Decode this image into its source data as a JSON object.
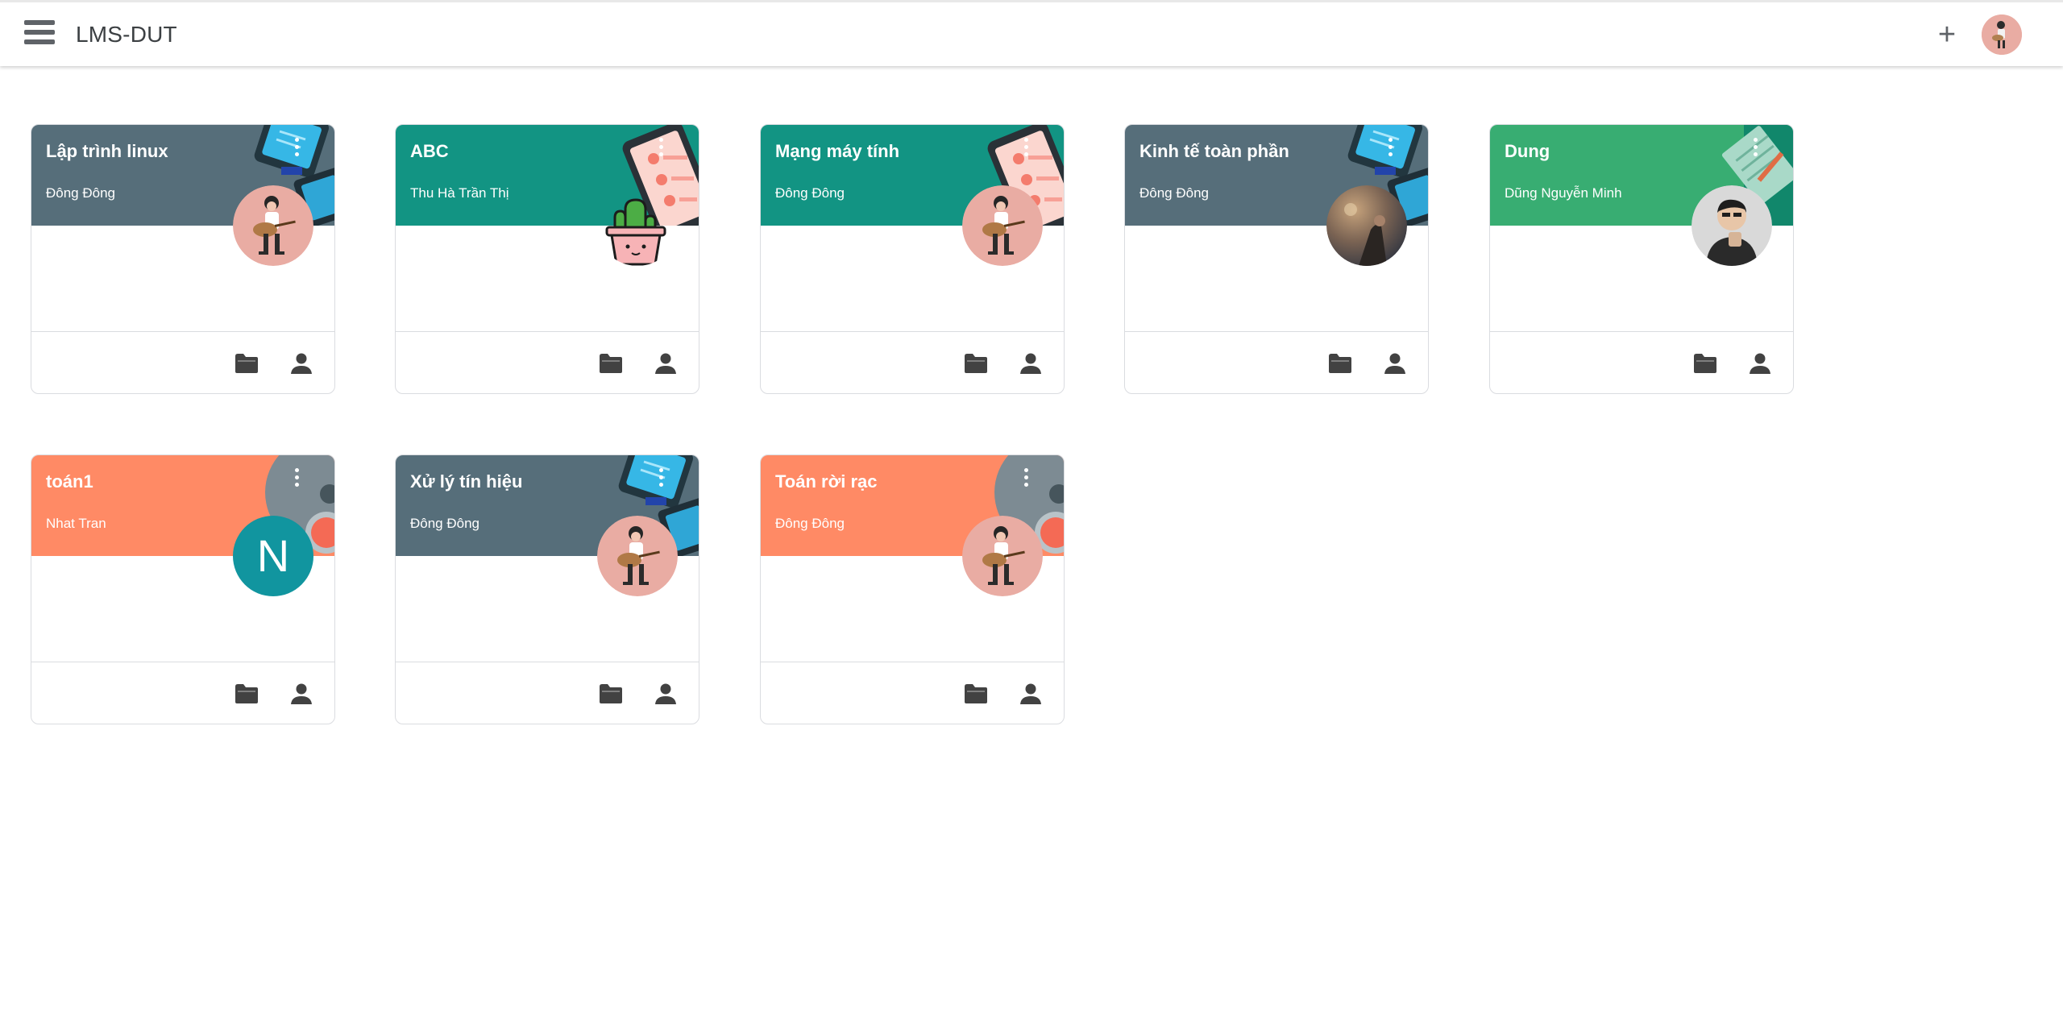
{
  "app": {
    "title": "LMS-DUT"
  },
  "header": {
    "add_icon": "plus-icon",
    "menu_icon": "hamburger-icon"
  },
  "colors": {
    "slate": "#566e7a",
    "teal": "#129483",
    "green": "#38ad72",
    "salmon": "#ff8a65",
    "avatar_n": "#11959f"
  },
  "classes": [
    {
      "title": "Lập trình linux",
      "teacher": "Đông Đông",
      "theme": "slate",
      "avatar": "guitar"
    },
    {
      "title": "ABC",
      "teacher": "Thu Hà Trần Thị",
      "theme": "teal",
      "avatar": "cactus"
    },
    {
      "title": "Mạng máy tính",
      "teacher": "Đông Đông",
      "theme": "teal",
      "avatar": "guitar"
    },
    {
      "title": "Kinh tế toàn phần",
      "teacher": "Đông Đông",
      "theme": "slate",
      "avatar": "photo"
    },
    {
      "title": "Dung",
      "teacher": "Dũng Nguyễn Minh",
      "theme": "green",
      "avatar": "person"
    },
    {
      "title": "toán1",
      "teacher": "Nhat Tran",
      "theme": "salmon",
      "avatar": "letter",
      "avatar_letter": "N"
    },
    {
      "title": "Xử lý tín hiệu",
      "teacher": "Đông Đông",
      "theme": "slate",
      "avatar": "guitar"
    },
    {
      "title": "Toán rời rạc",
      "teacher": "Đông Đông",
      "theme": "salmon",
      "avatar": "guitar"
    }
  ]
}
